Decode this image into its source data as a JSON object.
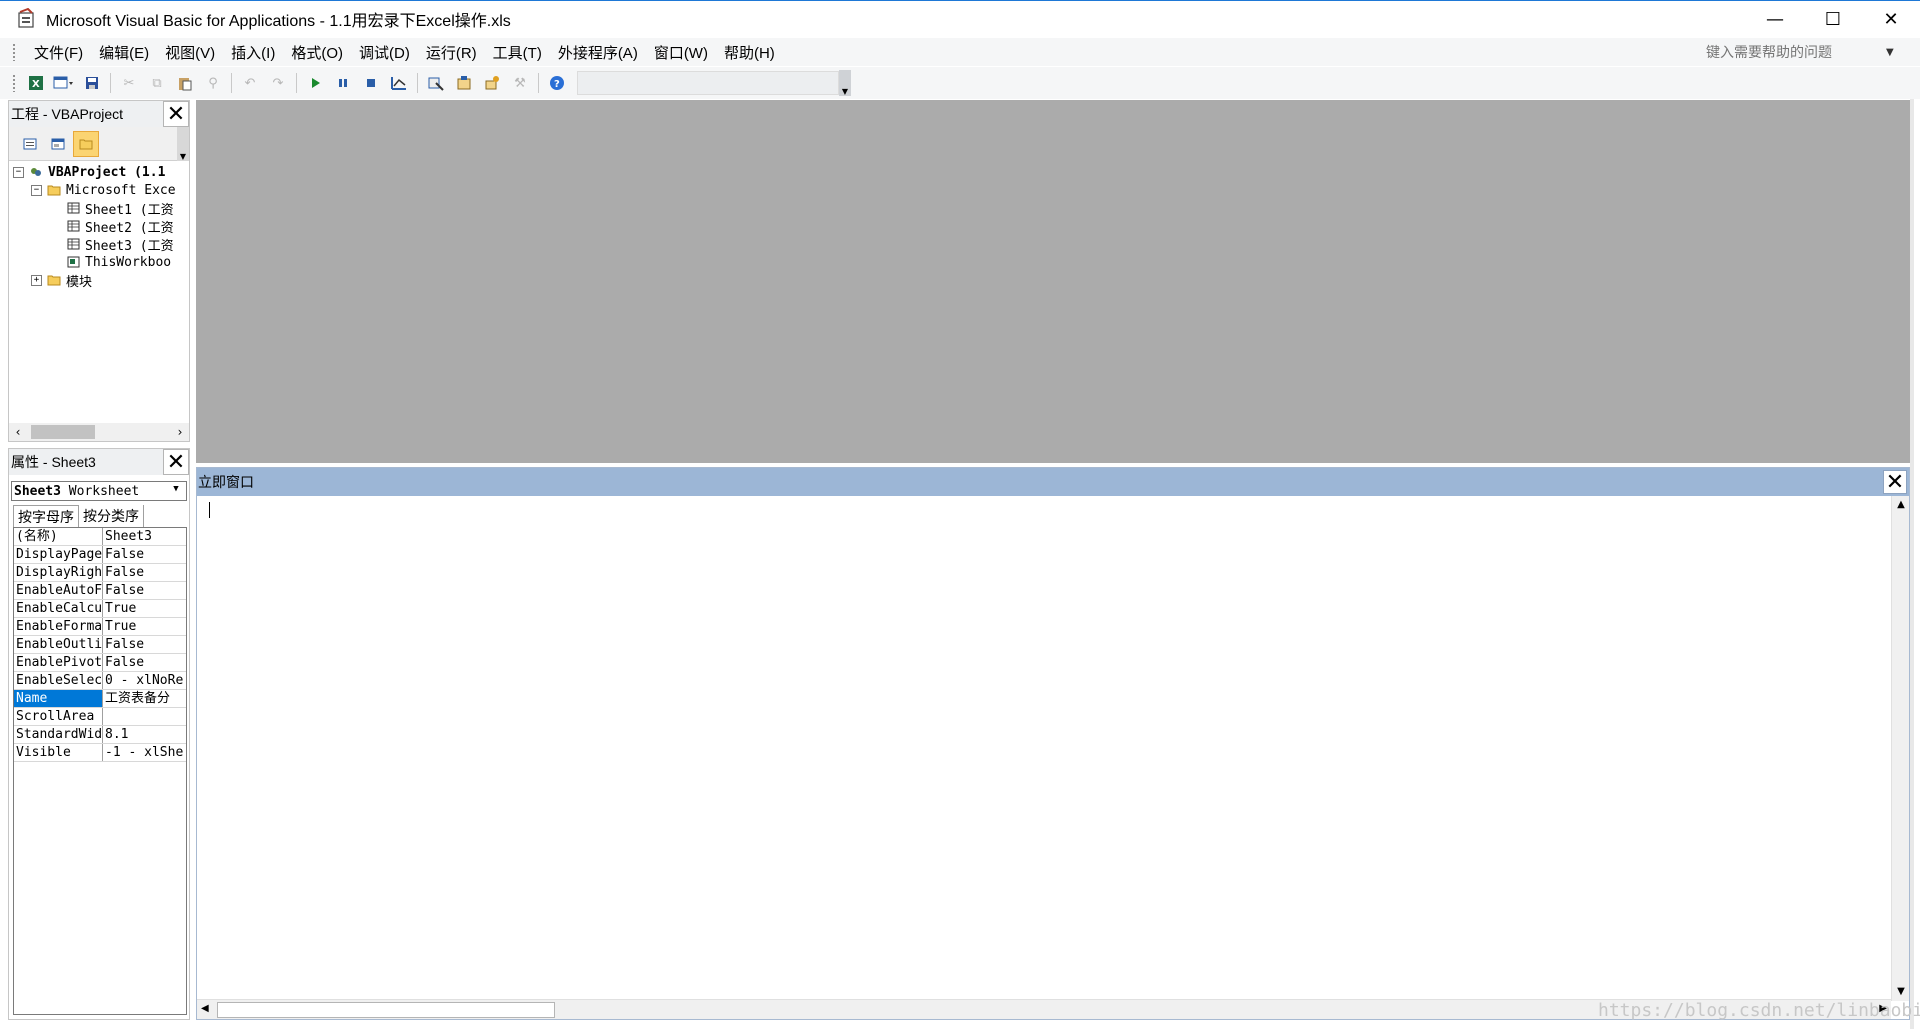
{
  "window": {
    "title": "Microsoft Visual Basic for Applications - 1.1用宏录下Excel操作.xls",
    "minimize": "—",
    "maximize": "☐",
    "close": "✕"
  },
  "menubar": {
    "items": [
      "文件(F)",
      "编辑(E)",
      "视图(V)",
      "插入(I)",
      "格式(O)",
      "调试(D)",
      "运行(R)",
      "工具(T)",
      "外接程序(A)",
      "窗口(W)",
      "帮助(H)"
    ],
    "help_placeholder": "键入需要帮助的问题"
  },
  "toolbar": {
    "icons": [
      "excel-icon",
      "insert-userform-icon",
      "save-icon",
      "cut-icon",
      "copy-icon",
      "paste-icon",
      "find-icon",
      "undo-icon",
      "redo-icon",
      "run-icon",
      "break-icon",
      "reset-icon",
      "design-mode-icon",
      "project-explorer-icon",
      "properties-window-icon",
      "object-browser-icon",
      "toolbox-icon",
      "help-icon"
    ]
  },
  "project_pane": {
    "title": "工程 - VBAProject",
    "tree": [
      {
        "label": "VBAProject (1.1",
        "level": 0,
        "expander": "−",
        "bold": true
      },
      {
        "label": "Microsoft Exce",
        "level": 1,
        "expander": "−",
        "bold": false
      },
      {
        "label": "Sheet1 (工资",
        "level": 2,
        "expander": "",
        "bold": false
      },
      {
        "label": "Sheet2 (工资",
        "level": 2,
        "expander": "",
        "bold": false
      },
      {
        "label": "Sheet3 (工资",
        "level": 2,
        "expander": "",
        "bold": false
      },
      {
        "label": "ThisWorkboo",
        "level": 2,
        "expander": "",
        "bold": false
      },
      {
        "label": "模块",
        "level": 1,
        "expander": "+",
        "bold": false
      }
    ]
  },
  "properties_pane": {
    "title": "属性 - Sheet3",
    "object_name": "Sheet3",
    "object_type": "Worksheet",
    "tabs": [
      "按字母序",
      "按分类序"
    ],
    "rows": [
      {
        "name": "(名称)",
        "value": "Sheet3"
      },
      {
        "name": "DisplayPageB",
        "value": "False"
      },
      {
        "name": "DisplayRight",
        "value": "False"
      },
      {
        "name": "EnableAutoFi",
        "value": "False"
      },
      {
        "name": "EnableCalcul",
        "value": "True"
      },
      {
        "name": "EnableFormat",
        "value": "True"
      },
      {
        "name": "EnableOutlin",
        "value": "False"
      },
      {
        "name": "EnablePivotT",
        "value": "False"
      },
      {
        "name": "EnableSelect",
        "value": "0 - xlNoRe"
      },
      {
        "name": "Name",
        "value": "工资表备分"
      },
      {
        "name": "ScrollArea",
        "value": ""
      },
      {
        "name": "StandardWidt",
        "value": "8.1"
      },
      {
        "name": "Visible",
        "value": "-1 - xlShe"
      }
    ],
    "selected_row": "Name"
  },
  "immediate_window": {
    "title": "立即窗口"
  },
  "watermark": "https://blog.csdn.net/linbaobin",
  "colors": {
    "accent": "#0078d7",
    "mdi_background": "#ababab",
    "immediate_header": "#9cb6d6"
  }
}
